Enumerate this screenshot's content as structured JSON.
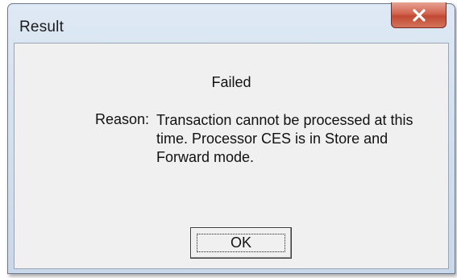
{
  "window": {
    "title": "Result",
    "close_icon": "close-icon"
  },
  "message": {
    "heading": "Failed",
    "reason_label": "Reason:",
    "reason_lines": [
      "Transaction cannot be processed at this",
      "time. Processor CES is in Store and",
      "Forward mode."
    ]
  },
  "buttons": {
    "ok_label": "OK"
  },
  "colors": {
    "close_button": "#c94f39",
    "titlebar": "#d6e2f0",
    "client_background": "#f0f0f0"
  }
}
